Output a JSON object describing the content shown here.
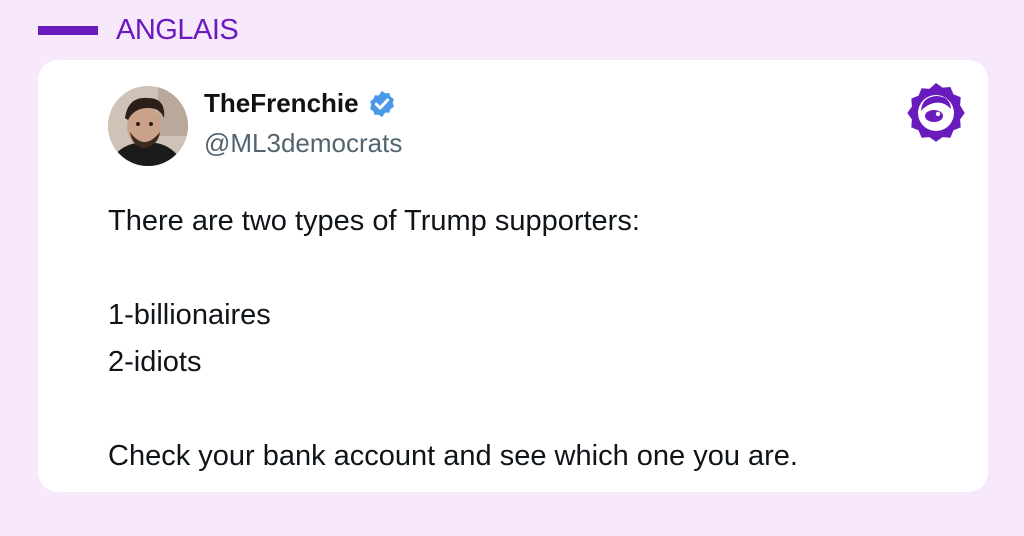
{
  "header": {
    "label": "ANGLAIS",
    "accent_color": "#6a1bbd"
  },
  "tweet": {
    "author": {
      "display_name": "TheFrenchie",
      "handle": "@ML3democrats",
      "verified": true,
      "avatar_icon": "avatar-photo",
      "verified_icon": "verified-badge-icon"
    },
    "lines": [
      "There are two types of Trump supporters:",
      "",
      "1-billionaires",
      "2-idiots",
      "",
      "Check your bank account and see which one you are."
    ]
  },
  "brand": {
    "icon": "brand-logo-icon",
    "color": "#6a1bbd"
  }
}
